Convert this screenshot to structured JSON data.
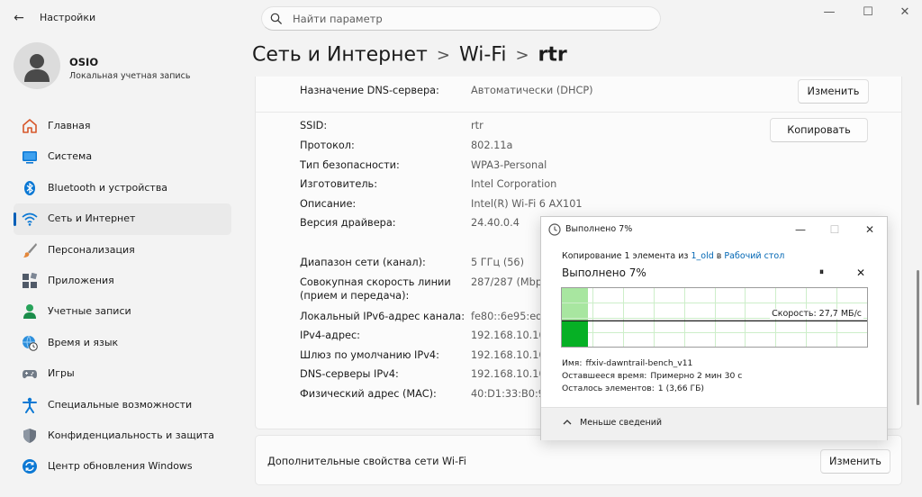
{
  "window": {
    "title": "Настройки",
    "back_glyph": "←",
    "minimize_glyph": "—",
    "maximize_glyph": "☐",
    "close_glyph": "✕"
  },
  "search": {
    "placeholder": "Найти параметр"
  },
  "account": {
    "name": "OSIO",
    "type": "Локальная учетная запись"
  },
  "nav": [
    {
      "label": "Главная",
      "icon": "home-icon"
    },
    {
      "label": "Система",
      "icon": "system-icon"
    },
    {
      "label": "Bluetooth и устройства",
      "icon": "bluetooth-icon"
    },
    {
      "label": "Сеть и Интернет",
      "icon": "wifi-icon",
      "active": true
    },
    {
      "label": "Персонализация",
      "icon": "brush-icon"
    },
    {
      "label": "Приложения",
      "icon": "apps-icon"
    },
    {
      "label": "Учетные записи",
      "icon": "person-icon"
    },
    {
      "label": "Время и язык",
      "icon": "globe-clock-icon"
    },
    {
      "label": "Игры",
      "icon": "gamepad-icon"
    },
    {
      "label": "Специальные возможности",
      "icon": "accessibility-icon"
    },
    {
      "label": "Конфиденциальность и защита",
      "icon": "shield-icon"
    },
    {
      "label": "Центр обновления Windows",
      "icon": "update-icon"
    }
  ],
  "breadcrumb": {
    "part1": "Сеть и Интернет",
    "part2": "Wi-Fi",
    "current": "rtr",
    "sep": ">"
  },
  "dns_row": {
    "label": "Назначение DNS-сервера:",
    "value": "Автоматически (DHCP)",
    "button": "Изменить"
  },
  "properties": {
    "copy_button": "Копировать",
    "rows": [
      {
        "label": "SSID:",
        "value": "rtr"
      },
      {
        "label": "Протокол:",
        "value": "802.11a"
      },
      {
        "label": "Тип безопасности:",
        "value": "WPA3-Personal"
      },
      {
        "label": "Изготовитель:",
        "value": "Intel Corporation"
      },
      {
        "label": "Описание:",
        "value": "Intel(R) Wi-Fi 6 AX101"
      },
      {
        "label": "Версия драйвера:",
        "value": "24.40.0.4"
      },
      {
        "label": "Диапазон сети (канал):",
        "value": "5 ГГц (56)"
      },
      {
        "label": "Совокупная скорость линии\n(прием и передача):",
        "value": "287/287 (Mbps"
      },
      {
        "label": "Локальный IPv6-адрес канала:",
        "value": "fe80::6e95:ed0"
      },
      {
        "label": "IPv4-адрес:",
        "value": "192.168.10.100"
      },
      {
        "label": "Шлюз по умолчанию IPv4:",
        "value": "192.168.10.10"
      },
      {
        "label": "DNS-серверы IPv4:",
        "value": "192.168.10.10 (6"
      },
      {
        "label": "Физический адрес (MAC):",
        "value": "40:D1:33:B0:9F:"
      }
    ]
  },
  "advanced": {
    "label": "Дополнительные свойства сети Wi-Fi",
    "button": "Изменить"
  },
  "copy_dialog": {
    "title": "Выполнено 7%",
    "subtitle_prefix": "Копирование 1 элемента из ",
    "source": "1_old",
    "subtitle_mid": " в ",
    "destination": "Рабочий стол",
    "heading": "Выполнено 7%",
    "pause_glyph": "⏸",
    "cancel_glyph": "✕",
    "progress": 0.07,
    "speed_label": "Скорость: 27,7 МБ/с",
    "name_label": "Имя:",
    "name_value": "ffxiv-dawntrail-bench_v11",
    "time_label": "Оставшееся время:",
    "time_value": "Примерно 2 мин 30 с",
    "items_label": "Осталось элементов:",
    "items_value": "1 (3,66 ГБ)",
    "less_details": "Меньше сведений"
  },
  "colors": {
    "accent": "#005fb8",
    "link": "#0066b4",
    "progress_fill": "#a8e6a0",
    "graph_fill": "#06b025"
  }
}
